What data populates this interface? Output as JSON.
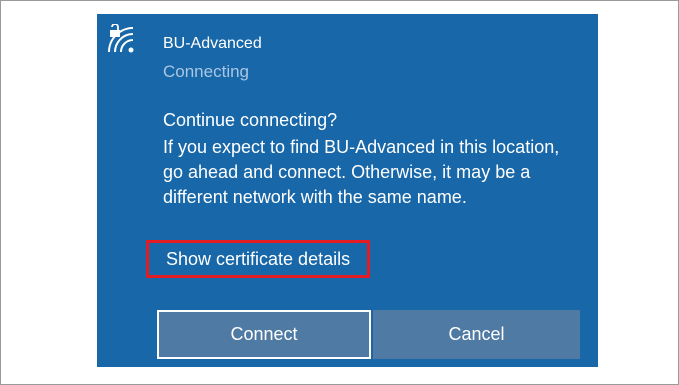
{
  "network": {
    "name": "BU-Advanced",
    "status": "Connecting",
    "icon": "wifi-secured-icon"
  },
  "prompt": {
    "title": "Continue connecting?",
    "body": "If you expect to find BU-Advanced in this location, go ahead and connect. Otherwise, it may be a different network with the same name.",
    "cert_link": "Show certificate details"
  },
  "buttons": {
    "connect": "Connect",
    "cancel": "Cancel"
  },
  "colors": {
    "flyout_background": "#1867a8",
    "button_background": "#4f7aa3",
    "highlight_border": "#e31b23",
    "status_text": "#a9c6e2"
  }
}
